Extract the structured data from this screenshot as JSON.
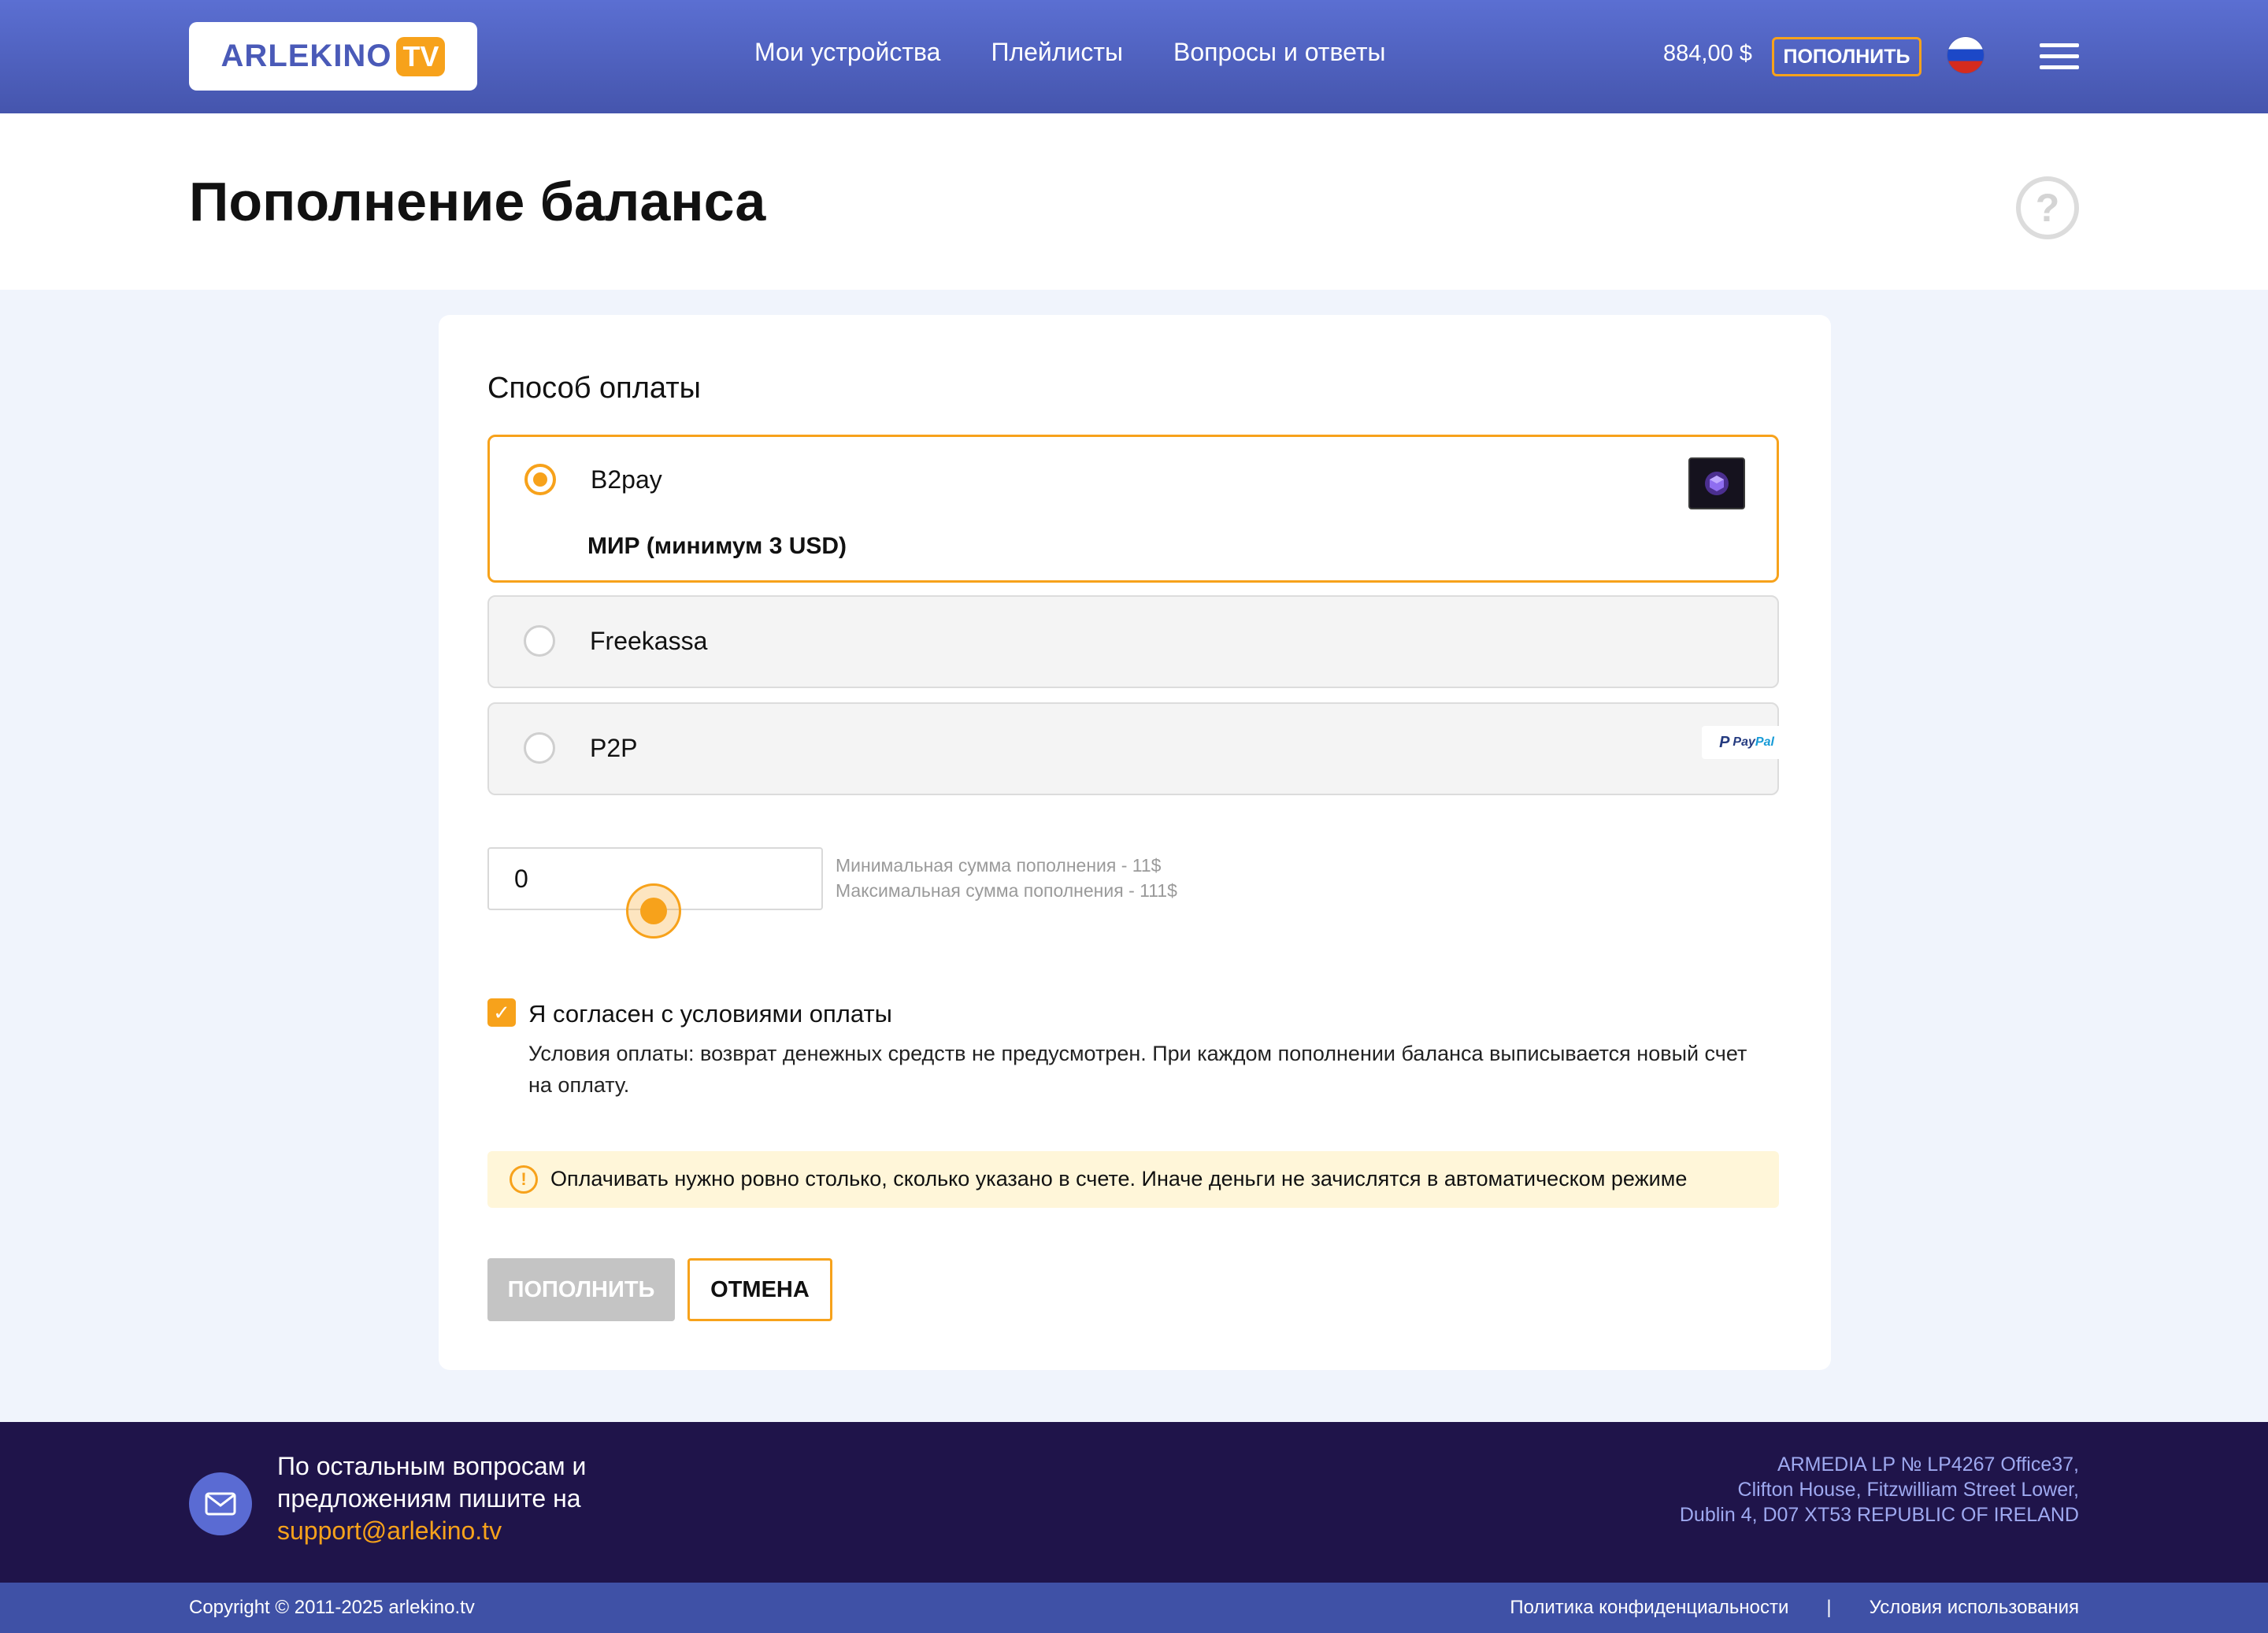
{
  "header": {
    "logo_text": "ARLEKINO",
    "logo_badge": "TV",
    "nav": [
      "Мои устройства",
      "Плейлисты",
      "Вопросы и ответы"
    ],
    "balance": "884,00 $",
    "topup_label": "ПОПОЛНИТЬ"
  },
  "page": {
    "title": "Пополнение баланса"
  },
  "payment": {
    "section_title": "Способ оплаты",
    "options": [
      {
        "label": "B2pay",
        "sub": "МИР (минимум 3 USD)",
        "selected": true,
        "icon": "b2pay-logo"
      },
      {
        "label": "Freekassa",
        "selected": false
      },
      {
        "label": "P2P",
        "selected": false,
        "icon": "paypal-logo"
      }
    ],
    "paypal_text": {
      "pay": "Pay",
      "pal": "Pal"
    }
  },
  "amount": {
    "value": "0",
    "min_hint": "Минимальная сумма пополнения - 11$",
    "max_hint": "Максимальная сумма пополнения - 111$"
  },
  "agreement": {
    "label": "Я согласен с условиями оплаты",
    "checked": true,
    "terms": "Условия оплаты: возврат денежных средств не предусмотрен. При каждом пополнении баланса выписывается новый счет на оплату."
  },
  "warning": {
    "text": "Оплачивать нужно ровно столько, сколько указано в счете. Иначе деньги не зачислятся в автоматическом режиме"
  },
  "buttons": {
    "topup": "ПОПОЛНИТЬ",
    "cancel": "ОТМЕНА"
  },
  "footer": {
    "contact_line1": "По остальным вопросам и",
    "contact_line2": "предложениям пишите на",
    "email": "support@arlekino.tv",
    "address_line1": "ARMEDIA LP № LP4267 Office37,",
    "address_line2": "Clifton House, Fitzwilliam Street Lower,",
    "address_line3": "Dublin 4, D07 XT53 REPUBLIC OF IRELAND",
    "copyright": "Copyright © 2011-2025 arlekino.tv",
    "privacy": "Политика конфиденциальности",
    "separator": "|",
    "terms_link": "Условия использования"
  },
  "colors": {
    "accent": "#f7a21b",
    "header": "#4f62c2",
    "footer": "#1f144a"
  }
}
